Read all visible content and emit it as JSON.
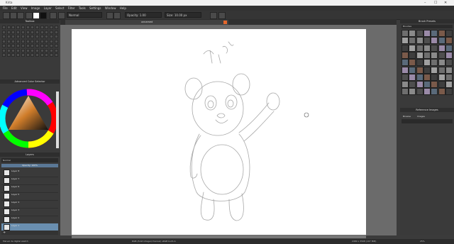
{
  "window": {
    "title": "Krita",
    "controls": [
      "–",
      "☐",
      "✕"
    ]
  },
  "menu": [
    "File",
    "Edit",
    "View",
    "Image",
    "Layer",
    "Select",
    "Filter",
    "Tools",
    "Settings",
    "Window",
    "Help"
  ],
  "toolbar": {
    "blend_mode": "Normal",
    "opacity_label": "Opacity: 1.00",
    "size_label": "Size: 10.00 px"
  },
  "panels": {
    "toolbox_title": "Toolbox",
    "color_title": "Advanced Color Selector",
    "layers_title": "Layers",
    "layers_mode": "Normal",
    "layers_opacity": "Opacity: 100%",
    "brush_title": "Brush Presets",
    "brush_filter": "Brushes",
    "ref_title": "Reference Images",
    "ref_tabs": [
      "Browse",
      "Images"
    ]
  },
  "document_tab": "unnamed",
  "layers": [
    "Layer 8",
    "Layer 7",
    "Layer 6",
    "Layer 5",
    "Layer 4",
    "Layer 3",
    "Layer 2",
    "Layer 1"
  ],
  "selected_layer_index": 7,
  "status": {
    "left": "Marvel 2e digital sketch",
    "middle": "RGB (8-bit integer/channel) sRGB built-in",
    "right": "2480 x 3508 (107 MiB)",
    "zoom": "25%"
  },
  "colors": {
    "accent": "#6a8fb0",
    "panel": "#3a3a3a"
  }
}
